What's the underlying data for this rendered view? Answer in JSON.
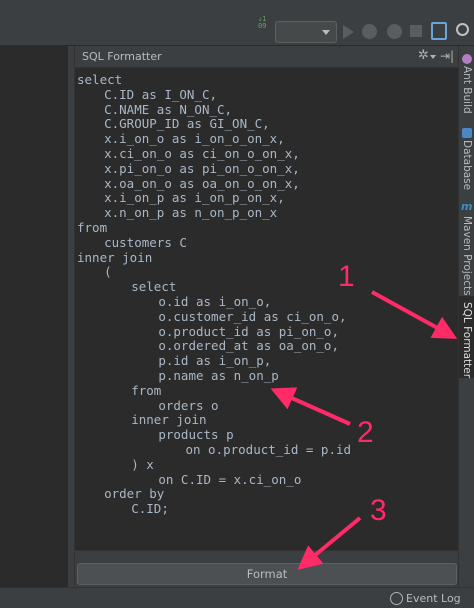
{
  "panel": {
    "title": "SQL Formatter",
    "gear_glyph": "✲",
    "hide_glyph": "⇥|"
  },
  "code_lines": [
    {
      "indent": 0,
      "text": "select"
    },
    {
      "indent": 4,
      "text": "C.ID as I_ON_C,"
    },
    {
      "indent": 4,
      "text": "C.NAME as N_ON_C,"
    },
    {
      "indent": 4,
      "text": "C.GROUP_ID as GI_ON_C,"
    },
    {
      "indent": 4,
      "text": "x.i_on_o as i_on_o_on_x,"
    },
    {
      "indent": 4,
      "text": "x.ci_on_o as ci_on_o_on_x,"
    },
    {
      "indent": 4,
      "text": "x.pi_on_o as pi_on_o_on_x,"
    },
    {
      "indent": 4,
      "text": "x.oa_on_o as oa_on_o_on_x,"
    },
    {
      "indent": 4,
      "text": "x.i_on_p as i_on_p_on_x,"
    },
    {
      "indent": 4,
      "text": "x.n_on_p as n_on_p_on_x"
    },
    {
      "indent": 0,
      "text": "from"
    },
    {
      "indent": 4,
      "text": "customers C"
    },
    {
      "indent": 0,
      "text": "inner join"
    },
    {
      "indent": 4,
      "text": "("
    },
    {
      "indent": 8,
      "text": "select"
    },
    {
      "indent": 12,
      "text": "o.id as i_on_o,"
    },
    {
      "indent": 12,
      "text": "o.customer_id as ci_on_o,"
    },
    {
      "indent": 12,
      "text": "o.product_id as pi_on_o,"
    },
    {
      "indent": 12,
      "text": "o.ordered_at as oa_on_o,"
    },
    {
      "indent": 12,
      "text": "p.id as i_on_p,"
    },
    {
      "indent": 12,
      "text": "p.name as n_on_p"
    },
    {
      "indent": 8,
      "text": "from"
    },
    {
      "indent": 12,
      "text": "orders o"
    },
    {
      "indent": 8,
      "text": "inner join"
    },
    {
      "indent": 12,
      "text": "products p"
    },
    {
      "indent": 16,
      "text": "on o.product_id = p.id"
    },
    {
      "indent": 8,
      "text": ") x"
    },
    {
      "indent": 12,
      "text": "on C.ID = x.ci_on_o"
    },
    {
      "indent": 4,
      "text": "order by"
    },
    {
      "indent": 8,
      "text": "C.ID;"
    }
  ],
  "format_button": "Format",
  "tool_tabs": {
    "ant_build": "Ant Build",
    "database": "Database",
    "maven": "Maven Projects",
    "maven_glyph": "m",
    "sql_formatter": "SQL Formatter"
  },
  "toolbar": {
    "sort_glyph": "↓1\n09"
  },
  "status": {
    "event_log": "Event Log"
  },
  "annotations": {
    "one": "1",
    "two": "2",
    "three": "3",
    "color": "#ff2a68"
  },
  "colors": {
    "editor_bg": "#2b2b2b",
    "panel_bg": "#3c3f41",
    "code_text": "#a9b7c6"
  }
}
